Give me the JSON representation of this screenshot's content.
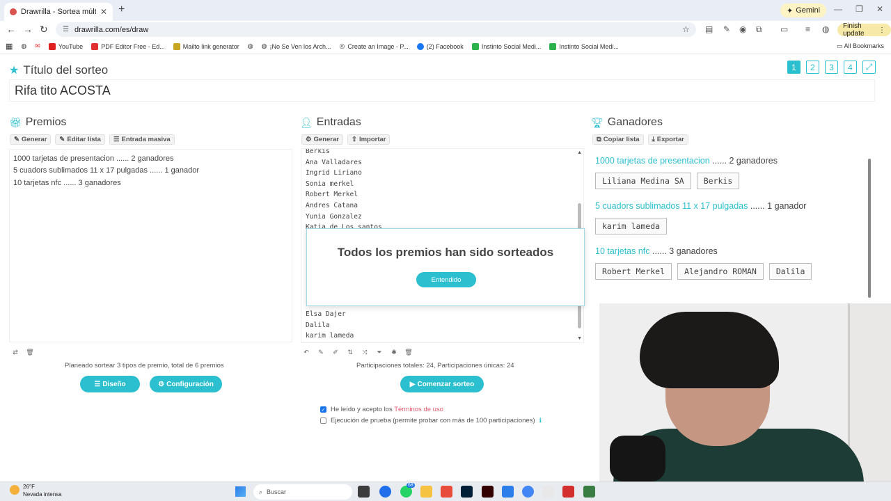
{
  "browser": {
    "tab_title": "Drawrilla - Sortea múltiples pre",
    "url": "drawrilla.com/es/draw",
    "gemini_label": "Gemini",
    "finish_update_label": "Finish update",
    "bookmarks": [
      {
        "label": "YouTube",
        "color": "#e02020"
      },
      {
        "label": "PDF Editor Free - Ed...",
        "color": "#e03030"
      },
      {
        "label": "Mailto link generator",
        "color": "#c7a520"
      },
      {
        "label": "",
        "color": "#555555"
      },
      {
        "label": "¡No Se Ven los Arch...",
        "color": "#555555"
      },
      {
        "label": "Create an Image - P...",
        "color": "#222222"
      },
      {
        "label": "(2) Facebook",
        "color": "#1877f2"
      },
      {
        "label": "Instinto Social Medi...",
        "color": "#2bb24c"
      },
      {
        "label": "Instinto Social Medi...",
        "color": "#2bb24c"
      }
    ],
    "all_bookmarks_label": "All Bookmarks"
  },
  "page": {
    "title_label": "Título del sorteo",
    "raffle_title": "Rifa tito ACOSTA",
    "pages": [
      "1",
      "2",
      "3",
      "4"
    ]
  },
  "prizes": {
    "heading": "Premios",
    "tools": [
      "Generar",
      "Editar lista",
      "Entrada masiva"
    ],
    "lines": [
      "1000 tarjetas de presentacion ...... 2 ganadores",
      "5 cuadors sublimados 11 x 17 pulgadas ...... 1 ganador",
      "10 tarjetas nfc ...... 3 ganadores"
    ],
    "summary": "Planeado sortear 3 tipos de premio, total de 6 premios",
    "design_label": "Diseño",
    "config_label": "Configuración"
  },
  "entries": {
    "heading": "Entradas",
    "tools": [
      "Generar",
      "Importar"
    ],
    "visible_top": [
      "Berkis",
      "Ana Valladares",
      "Ingrid Liriano",
      "Sonia merkel",
      "Robert Merkel",
      "Andres Catana",
      "Yunia Gonzalez",
      "Katia de Los santos"
    ],
    "visible_bottom": [
      "Elsa Dajer",
      "Dalila",
      "karim lameda"
    ],
    "summary": "Participaciones totales: 24, Participaciones únicas: 24",
    "start_label": "Comenzar sorteo",
    "terms_prefix": "He leído y acepto los",
    "terms_link": "Términos de uso",
    "terms_checked": true,
    "trial_label": "Ejecución de prueba (permite probar con más de 100 participaciones)",
    "trial_checked": false
  },
  "winners": {
    "heading": "Ganadores",
    "tools": [
      "Copiar lista",
      "Exportar"
    ],
    "groups": [
      {
        "prize": "1000 tarjetas de presentacion",
        "count": "...... 2 ganadores",
        "names": [
          "Liliana Medina SA",
          "Berkis"
        ]
      },
      {
        "prize": "5 cuadors sublimados 11 x 17 pulgadas",
        "count": "...... 1 ganador",
        "names": [
          "karim lameda"
        ]
      },
      {
        "prize": "10 tarjetas nfc",
        "count": "...... 3 ganadores",
        "names": [
          "Robert Merkel",
          "Alejandro ROMAN",
          "Dalila"
        ]
      }
    ]
  },
  "modal": {
    "title": "Todos los premios han sido sorteados",
    "ok_label": "Entendido"
  },
  "taskbar": {
    "temperature": "26°F",
    "weather": "Nevada intensa",
    "search_placeholder": "Buscar",
    "badge_count": "68"
  },
  "colors": {
    "accent": "#2bbfcf",
    "terms_link": "#e05d6f"
  }
}
